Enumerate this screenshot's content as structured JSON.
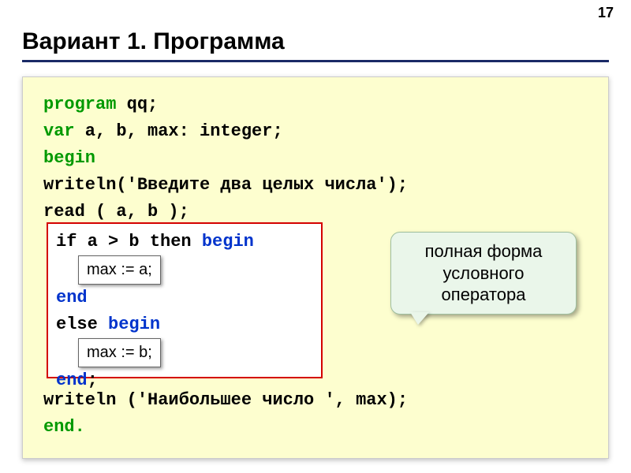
{
  "page_number": "17",
  "title": "Вариант 1. Программа",
  "code": {
    "l1a": "program",
    "l1b": " qq;",
    "l2a": "var",
    "l2b": " a, b, max: integer;",
    "l3": "begin",
    "l4": " writeln('Введите два целых числа');",
    "l5": " read ( a, b );",
    "l6a": " if a > b then ",
    "l6b": "begin",
    "chip1": "max := a;",
    "l8": "end",
    "l9a": "else ",
    "l9b": "begin",
    "chip2": "max := b;",
    "l11": "end",
    "l11s": ";",
    "l12": " writeln ('Наибольшее число ', max);",
    "l13": "end."
  },
  "callout": "полная форма условного оператора"
}
